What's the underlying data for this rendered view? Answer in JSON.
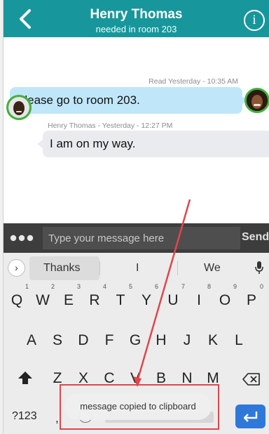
{
  "header": {
    "contact_name": "Henry Thomas",
    "subtitle": "needed in room 203",
    "info_glyph": "i"
  },
  "messages": [
    {
      "direction": "outgoing",
      "meta": "Read  Yesterday - 10:35 AM",
      "text": "Please go to room 203."
    },
    {
      "direction": "incoming",
      "meta": "Henry Thomas - Yesterday - 12:27 PM",
      "text": "I am on my way."
    }
  ],
  "composer": {
    "placeholder": "Type your message here",
    "send_label": "Send"
  },
  "keyboard": {
    "suggestions": [
      "Thanks",
      "I",
      "We"
    ],
    "row1": [
      {
        "letter": "Q",
        "number": "1"
      },
      {
        "letter": "W",
        "number": "2"
      },
      {
        "letter": "E",
        "number": "3"
      },
      {
        "letter": "R",
        "number": "4"
      },
      {
        "letter": "T",
        "number": "5"
      },
      {
        "letter": "Y",
        "number": "6"
      },
      {
        "letter": "U",
        "number": "7"
      },
      {
        "letter": "I",
        "number": "8"
      },
      {
        "letter": "O",
        "number": "9"
      },
      {
        "letter": "P",
        "number": "0"
      }
    ],
    "row2": [
      "A",
      "S",
      "D",
      "F",
      "G",
      "H",
      "J",
      "K",
      "L"
    ],
    "row3": [
      "Z",
      "X",
      "C",
      "V",
      "B",
      "N",
      "M"
    ],
    "symbols_label": "?123",
    "comma_label": ","
  },
  "toast": {
    "text": "message copied to clipboard"
  },
  "colors": {
    "header": "#17979b",
    "outgoing_bubble": "#bfe7f9",
    "incoming_bubble": "#e9ebee",
    "avatar_ring": "#41b23b",
    "enter_key": "#2f78d9",
    "annotation": "#e0464c"
  },
  "icons": {
    "back": "chevron-left-icon",
    "info": "info-circle-icon",
    "more": "more-dots-icon",
    "mic": "microphone-icon",
    "shift": "shift-arrow-icon",
    "backspace": "backspace-icon",
    "emoji": "emoji-icon",
    "enter": "enter-return-icon"
  }
}
